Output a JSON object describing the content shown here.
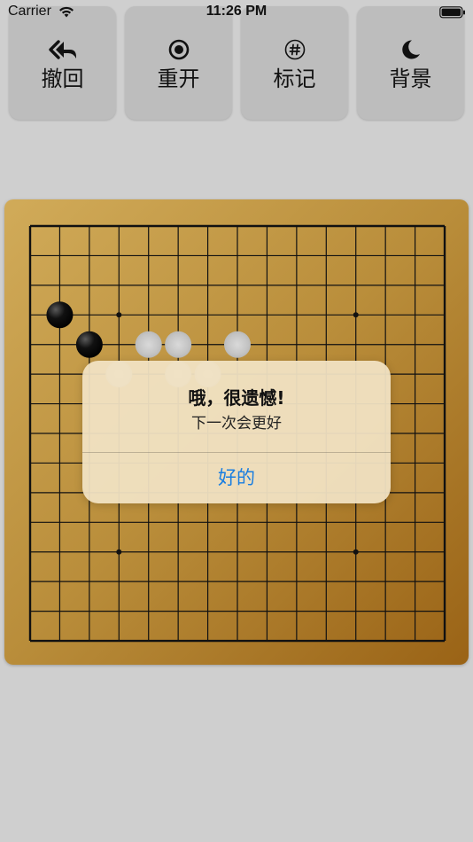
{
  "status_bar": {
    "carrier": "Carrier",
    "time": "11:26 PM",
    "wifi_icon": "wifi-icon",
    "battery_icon": "battery-full-icon"
  },
  "toolbar": {
    "undo": {
      "label": "撤回",
      "icon": "undo-icon"
    },
    "restart": {
      "label": "重开",
      "icon": "target-icon"
    },
    "mark": {
      "label": "标记",
      "icon": "hash-icon"
    },
    "background": {
      "label": "背景",
      "icon": "moon-icon"
    }
  },
  "board": {
    "size": 15,
    "star_points": [
      [
        3,
        3
      ],
      [
        3,
        11
      ],
      [
        11,
        3
      ],
      [
        11,
        11
      ]
    ],
    "stones": [
      {
        "col": 1,
        "row": 3,
        "color": "black"
      },
      {
        "col": 2,
        "row": 4,
        "color": "black"
      },
      {
        "col": 4,
        "row": 4,
        "color": "faded"
      },
      {
        "col": 5,
        "row": 4,
        "color": "faded"
      },
      {
        "col": 7,
        "row": 4,
        "color": "faded"
      },
      {
        "col": 3,
        "row": 5,
        "color": "faded"
      },
      {
        "col": 5,
        "row": 5,
        "color": "faded"
      },
      {
        "col": 6,
        "row": 5,
        "color": "faded"
      }
    ],
    "colors": {
      "line": "#111111",
      "black_stone": "#000000",
      "faded_stone": "#cfcfcf"
    }
  },
  "alert": {
    "title": "哦，很遗憾!",
    "message": "下一次会更好",
    "button_label": "好的",
    "button_color": "#1a7ee0"
  }
}
